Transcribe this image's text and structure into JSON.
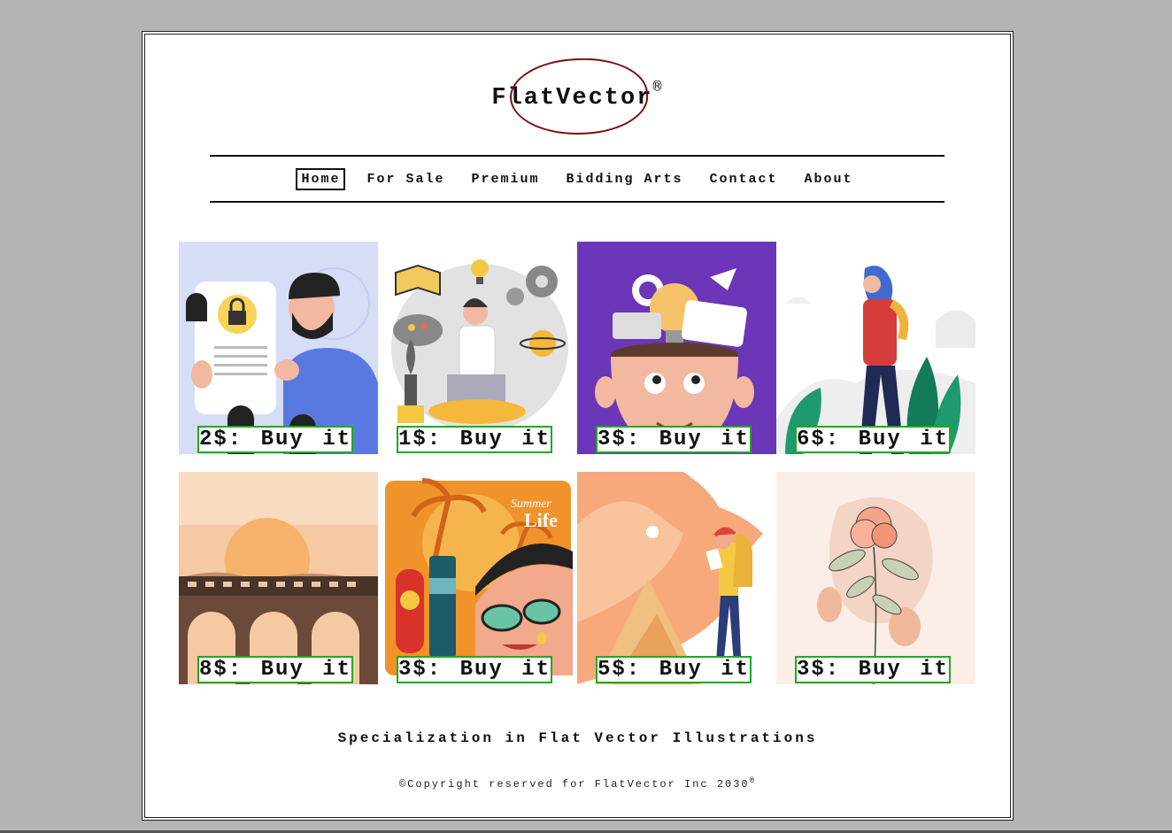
{
  "logo": {
    "text": "FlatVector",
    "mark": "®"
  },
  "nav": {
    "items": [
      {
        "label": "Home",
        "active": true
      },
      {
        "label": "For Sale"
      },
      {
        "label": "Premium"
      },
      {
        "label": "Bidding Arts"
      },
      {
        "label": "Contact"
      },
      {
        "label": "About"
      }
    ]
  },
  "products": [
    {
      "buy_label": "2$: Buy it",
      "art": "man-with-lock-document"
    },
    {
      "buy_label": "1$: Buy it",
      "art": "man-with-laptop-ideas"
    },
    {
      "buy_label": "3$: Buy it",
      "art": "boy-with-open-head-ideas"
    },
    {
      "buy_label": "6$: Buy it",
      "art": "woman-walking-plants"
    },
    {
      "buy_label": "8$: Buy it",
      "art": "train-on-bridge-sunset"
    },
    {
      "buy_label": "3$: Buy it",
      "art": "summer-life-woman-sunglasses"
    },
    {
      "buy_label": "5$: Buy it",
      "art": "hiker-in-mountains"
    },
    {
      "buy_label": "3$: Buy it",
      "art": "line-art-rose"
    }
  ],
  "colors": {
    "buy_border": "#1faa1f",
    "logo_ring": "#7a1010",
    "page_bg": "#b3b4b3"
  },
  "footer": {
    "tagline": "Specialization in Flat Vector Illustrations",
    "copyright": "©Copyright reserved for FlatVector Inc 2030",
    "mark": "®"
  }
}
